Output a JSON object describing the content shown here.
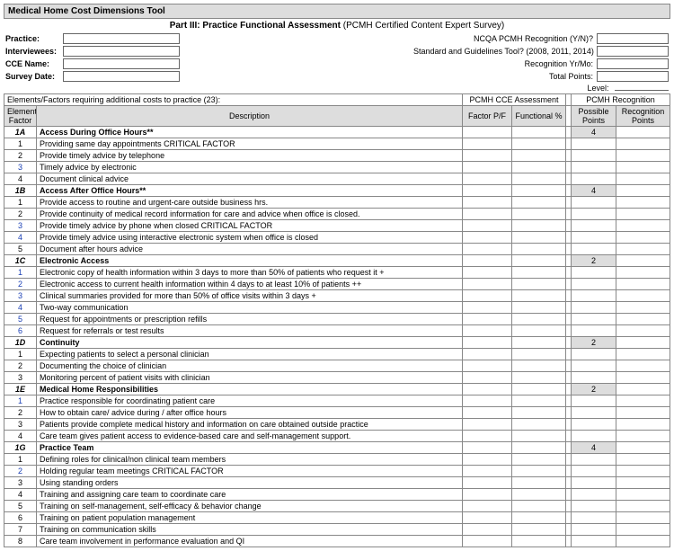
{
  "title": "Medical Home Cost Dimensions Tool",
  "part_line_bold": "Part III: Practice Functional Assessment",
  "part_line_rest": " (PCMH Certified Content Expert Survey)",
  "meta_left": {
    "practice": "Practice:",
    "interviewees": "Interviewees:",
    "cce": "CCE Name:",
    "survey_date": "Survey Date:"
  },
  "meta_right": {
    "recognition": "NCQA PCMH Recognition (Y/N)?",
    "standard": "Standard and Guidelines Tool? (2008, 2011, 2014)",
    "recog_yrmo": "Recognition Yr/Mo:",
    "total_points": "Total Points:",
    "level": "Level:"
  },
  "sub_header": "Elements/Factors requiring additional costs to practice (23):",
  "group_headers": {
    "assessment": "PCMH CCE Assessment",
    "recognition": "PCMH Recognition"
  },
  "columns": {
    "ef1": "Element/",
    "ef2": "Factor",
    "desc": "Description",
    "pf": "Factor P/F",
    "func": "Functional %",
    "pp1": "Possible",
    "pp2": "Points",
    "rp1": "Recognition",
    "rp2": "Points"
  },
  "sections": [
    {
      "id": "1A",
      "title": "Access During Office Hours**",
      "points": "4",
      "rows": [
        {
          "n": "1",
          "d": "Providing same day appointments CRITICAL FACTOR"
        },
        {
          "n": "2",
          "d": "Provide timely advice by telephone"
        },
        {
          "n": "3",
          "d": "Timely advice by electronic",
          "blue": true
        },
        {
          "n": "4",
          "d": "Document clinical advice"
        }
      ]
    },
    {
      "id": "1B",
      "title": "Access After Office Hours**",
      "points": "4",
      "rows": [
        {
          "n": "1",
          "d": "Provide access to routine and urgent-care outside business hrs."
        },
        {
          "n": "2",
          "d": "Provide continuity of medical record information for care and advice when office is closed."
        },
        {
          "n": "3",
          "d": "Provide timely advice by phone when closed CRITICAL FACTOR",
          "blue": true
        },
        {
          "n": "4",
          "d": "Provide timely advice using interactive electronic system when office is closed",
          "blue": true
        },
        {
          "n": "5",
          "d": "Document after hours advice"
        }
      ]
    },
    {
      "id": "1C",
      "title": "Electronic Access",
      "points": "2",
      "rows": [
        {
          "n": "1",
          "d": "Electronic copy of health information within 3 days to more than 50% of patients who request it +",
          "blue": true
        },
        {
          "n": "2",
          "d": "Electronic access to current health information within 4 days to at least 10% of patients ++",
          "blue": true
        },
        {
          "n": "3",
          "d": "Clinical summaries provided for more than 50% of office visits within 3 days +",
          "blue": true
        },
        {
          "n": "4",
          "d": "Two-way communication",
          "blue": true
        },
        {
          "n": "5",
          "d": "Request for appointments or prescription refills",
          "blue": true
        },
        {
          "n": "6",
          "d": "Request for referrals or test results",
          "blue": true
        }
      ]
    },
    {
      "id": "1D",
      "title": "Continuity",
      "points": "2",
      "rows": [
        {
          "n": "1",
          "d": "Expecting patients to select a personal clinician"
        },
        {
          "n": "2",
          "d": "Documenting the choice of clinician"
        },
        {
          "n": "3",
          "d": "Monitoring percent of patient visits with clinician"
        }
      ]
    },
    {
      "id": "1E",
      "title": "Medical Home Responsibilities",
      "points": "2",
      "rows": [
        {
          "n": "1",
          "d": "Practice responsible for coordinating patient care",
          "blue": true
        },
        {
          "n": "2",
          "d": "How to obtain care/ advice during / after office hours"
        },
        {
          "n": "3",
          "d": "Patients provide complete medical history and information on care obtained outside practice"
        },
        {
          "n": "4",
          "d": "Care team gives patient access to evidence-based care and self-management support."
        }
      ]
    },
    {
      "id": "1G",
      "title": "Practice Team",
      "points": "4",
      "rows": [
        {
          "n": "1",
          "d": "Defining roles for clinical/non clinical team members"
        },
        {
          "n": "2",
          "d": "Holding regular team meetings CRITICAL FACTOR",
          "blue": true
        },
        {
          "n": "3",
          "d": "Using standing orders"
        },
        {
          "n": "4",
          "d": "Training and assigning care team to coordinate care"
        },
        {
          "n": "5",
          "d": "Training on self-management, self-efficacy & behavior change"
        },
        {
          "n": "6",
          "d": "Training on patient population management"
        },
        {
          "n": "7",
          "d": "Training on communication skills"
        },
        {
          "n": "8",
          "d": "Care team involvement in performance evaluation and QI"
        }
      ]
    }
  ]
}
